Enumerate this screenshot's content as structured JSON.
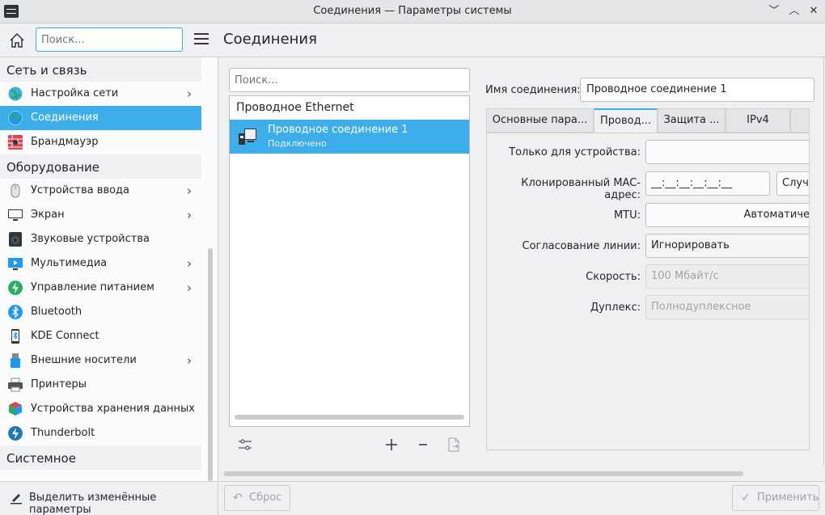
{
  "window": {
    "title": "Соединения — Параметры системы",
    "controls": [
      "﹀",
      "︿",
      "✕"
    ]
  },
  "left_toolbar": {
    "search_placeholder": "Поиск..."
  },
  "sidebar": {
    "groups": [
      {
        "label": "Сеть и связь",
        "items": [
          {
            "label": "Настройка сети",
            "has_children": true,
            "icon": "globe-icon",
            "selected": false
          },
          {
            "label": "Соединения",
            "has_children": false,
            "icon": "network-connections-icon",
            "selected": true
          },
          {
            "label": "Брандмауэр",
            "has_children": false,
            "icon": "firewall-icon",
            "selected": false
          }
        ]
      },
      {
        "label": "Оборудование",
        "items": [
          {
            "label": "Устройства ввода",
            "has_children": true,
            "icon": "mouse-icon",
            "selected": false
          },
          {
            "label": "Экран",
            "has_children": true,
            "icon": "monitor-icon",
            "selected": false
          },
          {
            "label": "Звуковые устройства",
            "has_children": false,
            "icon": "speaker-icon",
            "selected": false
          },
          {
            "label": "Мультимедиа",
            "has_children": true,
            "icon": "multimedia-icon",
            "selected": false
          },
          {
            "label": "Управление питанием",
            "has_children": true,
            "icon": "power-icon",
            "selected": false
          },
          {
            "label": "Bluetooth",
            "has_children": false,
            "icon": "bluetooth-icon",
            "selected": false
          },
          {
            "label": "KDE Connect",
            "has_children": false,
            "icon": "phone-icon",
            "selected": false
          },
          {
            "label": "Внешние носители",
            "has_children": true,
            "icon": "usb-icon",
            "selected": false
          },
          {
            "label": "Принтеры",
            "has_children": false,
            "icon": "printer-icon",
            "selected": false
          },
          {
            "label": "Устройства хранения данных",
            "has_children": false,
            "icon": "storage-icon",
            "selected": false
          },
          {
            "label": "Thunderbolt",
            "has_children": false,
            "icon": "thunderbolt-icon",
            "selected": false
          }
        ]
      },
      {
        "label": "Системное администрирование",
        "items": []
      }
    ],
    "highlight_label": "Выделить изменённые параметры"
  },
  "page": {
    "title": "Соединения"
  },
  "connections": {
    "search_placeholder": "Поиск...",
    "group_label": "Проводное Ethernet",
    "items": [
      {
        "name": "Проводное соединение 1",
        "status": "Подключено"
      }
    ]
  },
  "editor": {
    "name_label": "Имя соединения:",
    "name_value": "Проводное соединение 1",
    "tabs": [
      "Основные пара...",
      "Провод...",
      "Защита ...",
      "IPv4",
      ""
    ],
    "active_tab": 1,
    "fields": {
      "device_label": "Только для устройства:",
      "device_value": "",
      "mac_label": "Клонированный MAC-адрес:",
      "mac_value": "__:__:__:__:__:__",
      "random_button": "Случа",
      "mtu_label": "MTU:",
      "mtu_value": "Автоматиче",
      "negotiation_label": "Согласование линии:",
      "negotiation_value": "Игнорировать",
      "speed_label": "Скорость:",
      "speed_value": "100 Мбайт/с",
      "duplex_label": "Дуплекс:",
      "duplex_value": "Полнодуплексное"
    }
  },
  "footer": {
    "reset_label": "Сброс",
    "apply_label": "Применить"
  },
  "colors": {
    "accent": "#3daee9",
    "window_bg": "#eff0f1",
    "text": "#232629"
  }
}
